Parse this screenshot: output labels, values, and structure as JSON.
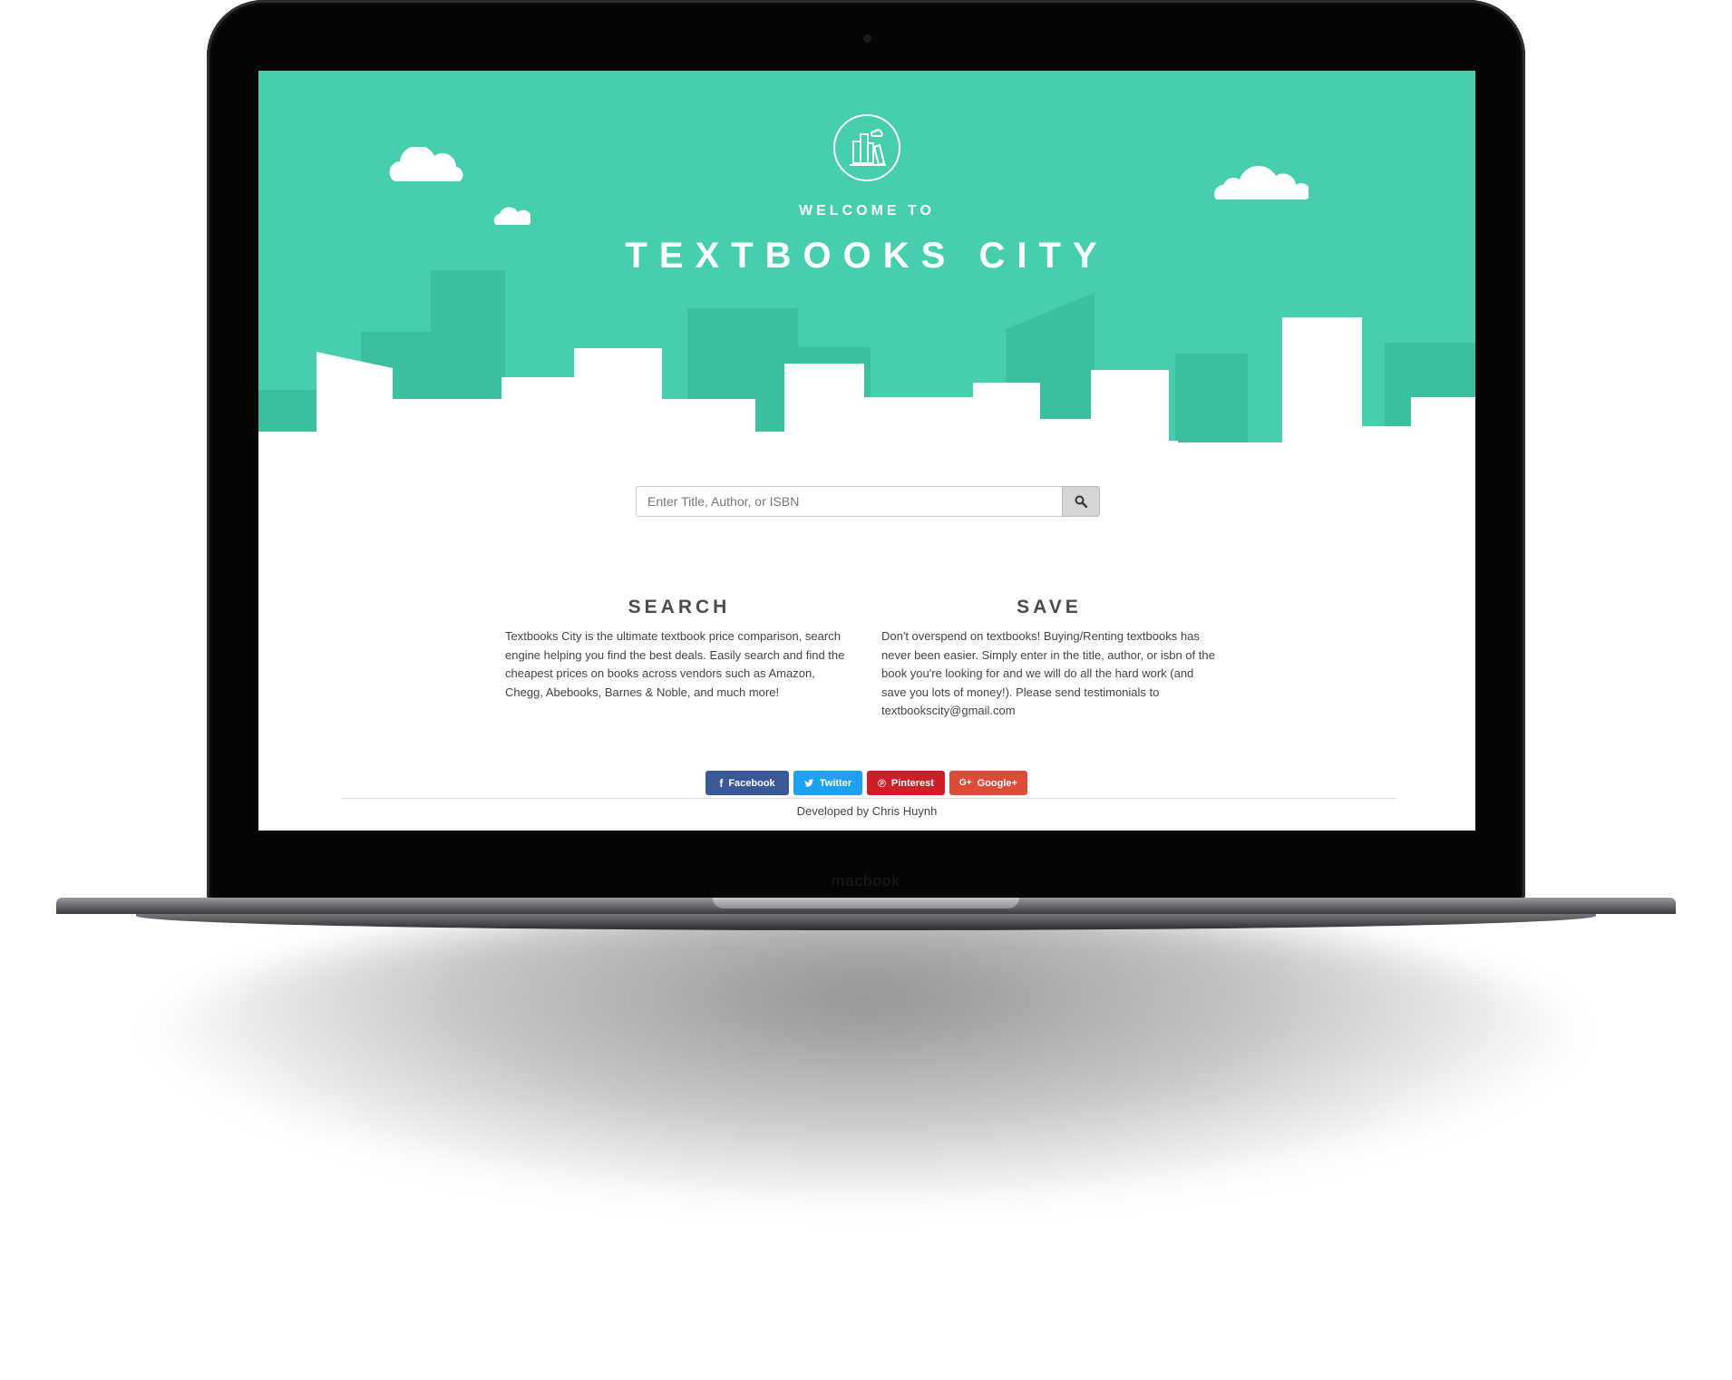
{
  "device": {
    "chin_label": "macbook"
  },
  "hero": {
    "welcome": "WELCOME TO",
    "title": "TEXTBOOKS CITY",
    "logo": "bookshelf-city-icon"
  },
  "search": {
    "placeholder": "Enter Title, Author, or ISBN",
    "value": "",
    "button_icon": "search-icon"
  },
  "columns": {
    "search": {
      "heading": "SEARCH",
      "body": "Textbooks City is the ultimate textbook price comparison, search engine helping you find the best deals. Easily search and find the cheapest prices on books across vendors such as Amazon, Chegg, Abebooks, Barnes & Noble, and much more!"
    },
    "save": {
      "heading": "SAVE",
      "body": "Don't overspend on textbooks! Buying/Renting textbooks has never been easier. Simply enter in the title, author, or isbn of the book you're looking for and we will do all the hard work (and save you lots of money!). Please send testimonials to textbookscity@gmail.com"
    }
  },
  "share": {
    "facebook": {
      "label": "Facebook",
      "icon": "facebook-icon",
      "color": "#3b5998"
    },
    "twitter": {
      "label": "Twitter",
      "icon": "twitter-icon",
      "color": "#1da1f2"
    },
    "pinterest": {
      "label": "Pinterest",
      "icon": "pinterest-icon",
      "color": "#cb2027"
    },
    "google": {
      "label": "Google+",
      "icon": "google-plus-icon",
      "color": "#dd4b39"
    }
  },
  "footer": {
    "credit": "Developed by Chris Huynh"
  },
  "colors": {
    "hero_bg": "#47ceac",
    "building_dark": "#3bbf9f",
    "heading_text": "#4b4b4b"
  }
}
